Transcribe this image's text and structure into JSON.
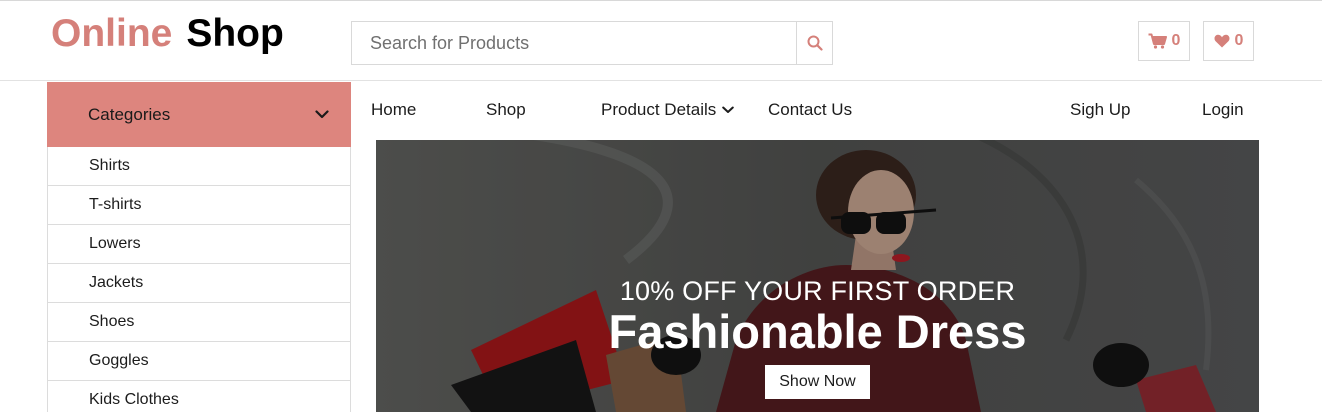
{
  "header": {
    "logo_first": "Online",
    "logo_second": "Shop",
    "search_placeholder": "Search for Products",
    "search_icon": "search-icon",
    "cart_icon": "cart-icon",
    "cart_count": "0",
    "wishlist_icon": "heart-icon",
    "wishlist_count": "0"
  },
  "categories": {
    "title": "Categories",
    "toggle_icon": "chevron-down-icon",
    "items": [
      {
        "label": "Shirts"
      },
      {
        "label": "T-shirts"
      },
      {
        "label": "Lowers"
      },
      {
        "label": "Jackets"
      },
      {
        "label": "Shoes"
      },
      {
        "label": "Goggles"
      },
      {
        "label": "Kids Clothes"
      }
    ]
  },
  "nav": {
    "home": "Home",
    "shop": "Shop",
    "product_details": "Product Details",
    "contact": "Contact Us",
    "signup": "Sigh Up",
    "login": "Login"
  },
  "hero": {
    "subtitle": "10% OFF YOUR FIRST ORDER",
    "title": "Fashionable Dress",
    "button": "Show Now"
  },
  "colors": {
    "accent": "#d5807a",
    "category_header": "#dd857e",
    "hero_overlay": "#5b5c5a"
  }
}
